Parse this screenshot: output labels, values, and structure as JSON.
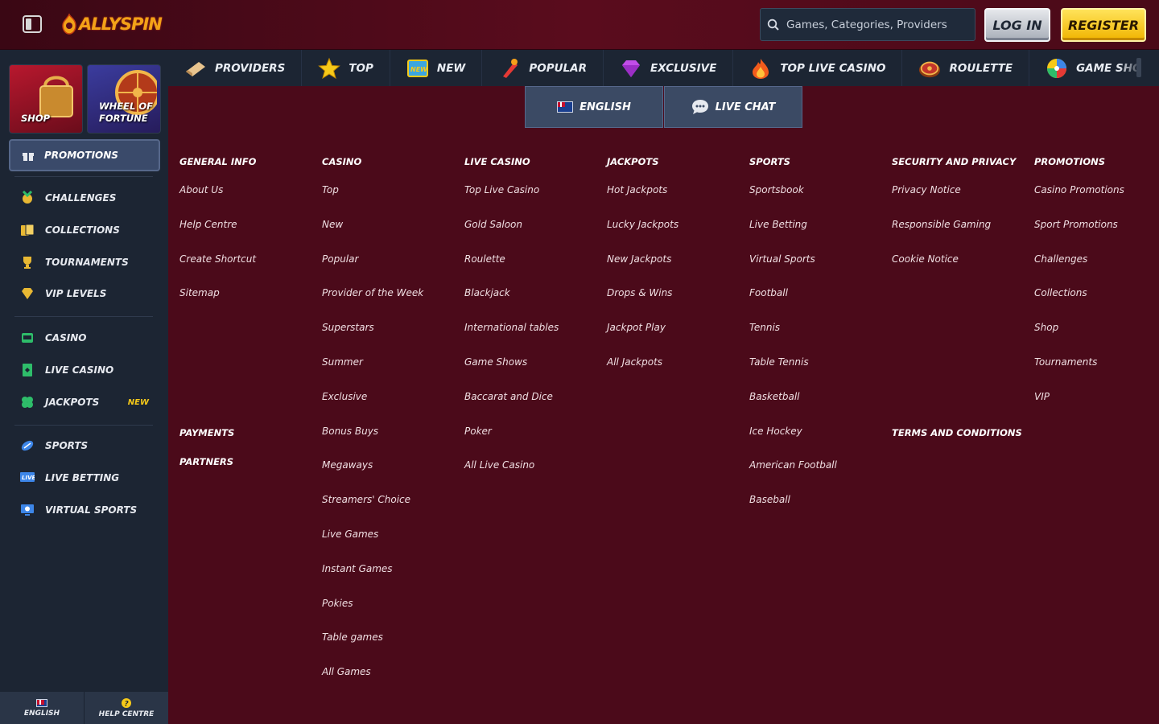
{
  "header": {
    "logo_text": "ALLYSPIN",
    "search_placeholder": "Games, Categories, Providers",
    "login_label": "LOG IN",
    "register_label": "REGISTER"
  },
  "sidebar": {
    "tiles": [
      {
        "label_line1": "SHOP",
        "label_line2": ""
      },
      {
        "label_line1": "WHEEL OF",
        "label_line2": "FORTUNE"
      }
    ],
    "promotions_label": "PROMOTIONS",
    "group1": [
      {
        "label": "CHALLENGES",
        "icon": "medal-icon"
      },
      {
        "label": "COLLECTIONS",
        "icon": "cards-icon"
      },
      {
        "label": "TOURNAMENTS",
        "icon": "trophy-icon"
      },
      {
        "label": "VIP LEVELS",
        "icon": "diamond-icon"
      }
    ],
    "group2": [
      {
        "label": "CASINO",
        "icon": "slot-icon"
      },
      {
        "label": "LIVE CASINO",
        "icon": "card-icon"
      },
      {
        "label": "JACKPOTS",
        "icon": "clover-icon",
        "badge": "NEW"
      }
    ],
    "group3": [
      {
        "label": "SPORTS",
        "icon": "football-icon"
      },
      {
        "label": "LIVE BETTING",
        "icon": "live-icon"
      },
      {
        "label": "VIRTUAL SPORTS",
        "icon": "virtual-icon"
      }
    ],
    "bottom": {
      "language": "ENGLISH",
      "help": "HELP CENTRE"
    }
  },
  "catnav": [
    {
      "label": "PROVIDERS",
      "icon": "providers-icon"
    },
    {
      "label": "TOP",
      "icon": "star-icon"
    },
    {
      "label": "NEW",
      "icon": "new-icon"
    },
    {
      "label": "POPULAR",
      "icon": "popular-icon"
    },
    {
      "label": "EXCLUSIVE",
      "icon": "gem-icon"
    },
    {
      "label": "TOP LIVE CASINO",
      "icon": "fire-icon"
    },
    {
      "label": "ROULETTE",
      "icon": "roulette-icon"
    },
    {
      "label": "GAME SHOWS",
      "icon": "wheel-icon"
    }
  ],
  "language_button": "ENGLISH",
  "chat_button": "LIVE CHAT",
  "columns": [
    {
      "heading": "GENERAL INFO",
      "links": [
        "About Us",
        "Help Centre",
        "Create Shortcut",
        "Sitemap"
      ],
      "extra_headings": [
        "PAYMENTS",
        "PARTNERS"
      ]
    },
    {
      "heading": "CASINO",
      "links": [
        "Top",
        "New",
        "Popular",
        "Provider of the Week",
        "Superstars",
        "Summer",
        "Exclusive",
        "Bonus Buys",
        "Megaways",
        "Streamers' Choice",
        "Live Games",
        "Instant Games",
        "Pokies",
        "Table games",
        "All Games"
      ]
    },
    {
      "heading": "LIVE CASINO",
      "links": [
        "Top Live Casino",
        "Gold Saloon",
        "Roulette",
        "Blackjack",
        "International tables",
        "Game Shows",
        "Baccarat and Dice",
        "Poker",
        "All Live Casino"
      ]
    },
    {
      "heading": "JACKPOTS",
      "links": [
        "Hot Jackpots",
        "Lucky Jackpots",
        "New Jackpots",
        "Drops & Wins",
        "Jackpot Play",
        "All Jackpots"
      ]
    },
    {
      "heading": "SPORTS",
      "links": [
        "Sportsbook",
        "Live Betting",
        "Virtual Sports",
        "Football",
        "Tennis",
        "Table Tennis",
        "Basketball",
        "Ice Hockey",
        "American Football",
        "Baseball"
      ]
    },
    {
      "heading": "SECURITY AND PRIVACY",
      "links": [
        "Privacy Notice",
        "Responsible Gaming",
        "Cookie Notice"
      ],
      "extra_headings": [
        "TERMS AND CONDITIONS"
      ]
    },
    {
      "heading": "PROMOTIONS",
      "links": [
        "Casino Promotions",
        "Sport Promotions",
        "Challenges",
        "Collections",
        "Shop",
        "Tournaments",
        "VIP"
      ]
    }
  ]
}
